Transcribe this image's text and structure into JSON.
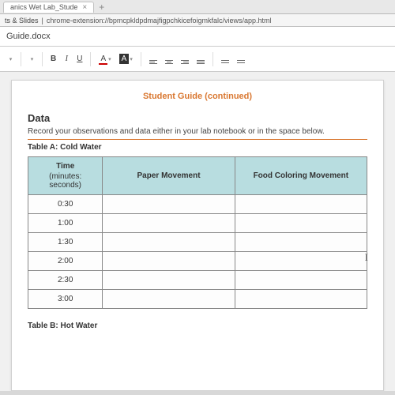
{
  "tab": {
    "title": "anics Wet Lab_Stude",
    "close": "×",
    "add": "+"
  },
  "address": {
    "prefix": "ts & Slides",
    "sep": "|",
    "url": "chrome-extension://bpmcpkldpdmajfigpchkicefoigmkfalc/views/app.html"
  },
  "filename": "Guide.docx",
  "toolbar": {
    "bold": "B",
    "italic": "I",
    "underline": "U",
    "font_color": "A",
    "fill_color": "A"
  },
  "doc": {
    "guide_header": "Student Guide (continued)",
    "data_heading": "Data",
    "data_instruction": "Record your observations and data either in your lab notebook or in the space below.",
    "table_a_label": "Table A: Cold Water",
    "table_a": {
      "headers": {
        "time": "Time",
        "time_sub": "(minutes: seconds)",
        "paper": "Paper Movement",
        "food": "Food Coloring Movement"
      },
      "rows": [
        "0:30",
        "1:00",
        "1:30",
        "2:00",
        "2:30",
        "3:00"
      ]
    },
    "table_b_label": "Table B: Hot Water"
  }
}
